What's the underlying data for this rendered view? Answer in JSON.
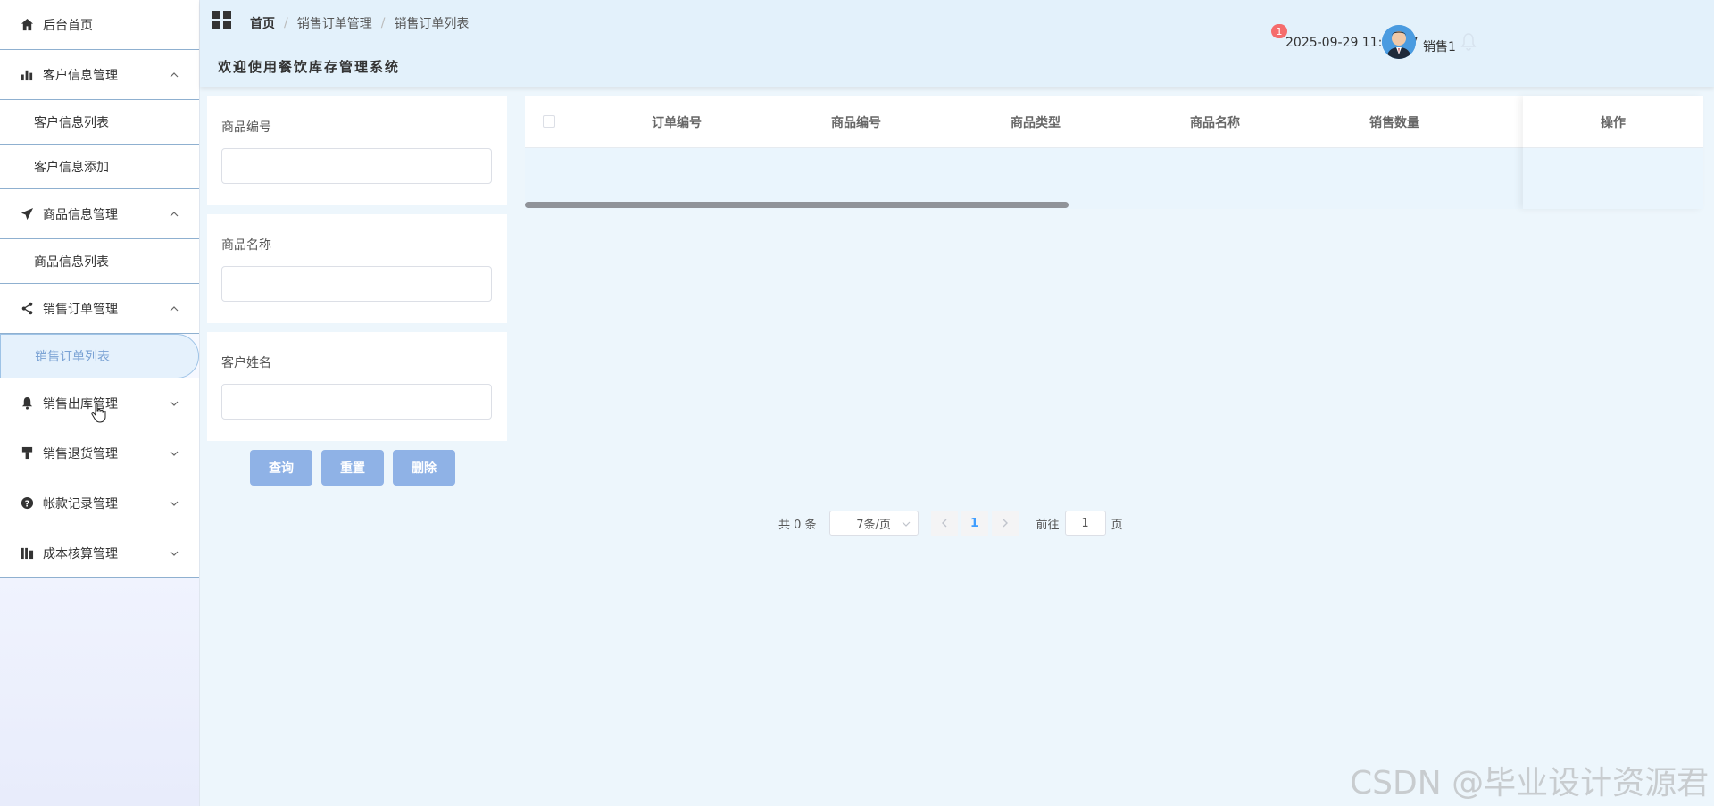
{
  "sidebar": {
    "items": [
      {
        "label": "后台首页",
        "icon": "home-icon"
      },
      {
        "label": "客户信息管理",
        "icon": "bar-chart-icon",
        "expanded": true,
        "children": [
          {
            "label": "客户信息列表"
          },
          {
            "label": "客户信息添加"
          }
        ]
      },
      {
        "label": "商品信息管理",
        "icon": "paper-plane-icon",
        "expanded": true,
        "children": [
          {
            "label": "商品信息列表"
          }
        ]
      },
      {
        "label": "销售订单管理",
        "icon": "share-icon",
        "expanded": true,
        "children": [
          {
            "label": "销售订单列表",
            "active": true
          }
        ]
      },
      {
        "label": "销售出库管理",
        "icon": "bell-icon",
        "expanded": false
      },
      {
        "label": "销售退货管理",
        "icon": "brush-icon",
        "expanded": false
      },
      {
        "label": "帐款记录管理",
        "icon": "question-icon",
        "expanded": false
      },
      {
        "label": "成本核算管理",
        "icon": "columns-icon",
        "expanded": false
      }
    ]
  },
  "header": {
    "breadcrumb": [
      "首页",
      "销售订单管理",
      "销售订单列表"
    ],
    "site_title": "欢迎使用餐饮库存管理系统",
    "datetime": "2025-09-29 11:36:27",
    "notification_count": "1",
    "username": "销售1"
  },
  "search": {
    "fields": [
      {
        "label": "商品编号",
        "value": ""
      },
      {
        "label": "商品名称",
        "value": ""
      },
      {
        "label": "客户姓名",
        "value": ""
      }
    ],
    "buttons": {
      "query": "查询",
      "reset": "重置",
      "delete": "删除"
    }
  },
  "table": {
    "columns": [
      "订单编号",
      "商品编号",
      "商品类型",
      "商品名称",
      "销售数量"
    ],
    "action_column": "操作",
    "rows": []
  },
  "pagination": {
    "total": "共 0 条",
    "page_size": "7条/页",
    "current_page": "1",
    "goto_label": "前往",
    "goto_value": "1",
    "page_unit": "页"
  },
  "watermark": "CSDN @毕业设计资源君",
  "colors": {
    "accent": "#409eff",
    "button": "#8fb2e6",
    "badge": "#f56c6c",
    "header_bg": "#e3f1fb",
    "page_bg": "#edf6fc"
  }
}
